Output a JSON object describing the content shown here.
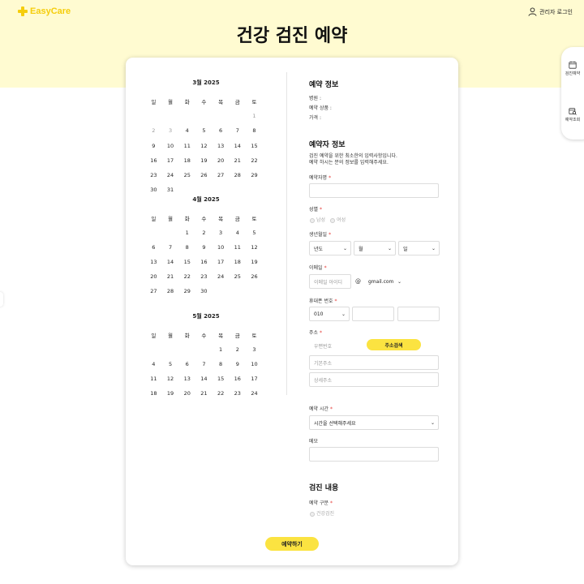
{
  "header": {
    "logo_text": "EasyCare",
    "admin_login": "관리자 로그인",
    "page_title": "건강 검진 예약"
  },
  "side_menu": {
    "checkup_label": "검진예약",
    "inquiry_label": "예약조회"
  },
  "calendars": [
    {
      "title": "3월 2025",
      "weekdays": [
        "일",
        "월",
        "화",
        "수",
        "목",
        "금",
        "토"
      ],
      "weeks": [
        [
          "",
          "",
          "",
          "",
          "",
          "",
          "1"
        ],
        [
          "2",
          "3",
          "4",
          "5",
          "6",
          "7",
          "8"
        ],
        [
          "9",
          "10",
          "11",
          "12",
          "13",
          "14",
          "15"
        ],
        [
          "16",
          "17",
          "18",
          "19",
          "20",
          "21",
          "22"
        ],
        [
          "23",
          "24",
          "25",
          "26",
          "27",
          "28",
          "29"
        ],
        [
          "30",
          "31",
          "",
          "",
          "",
          "",
          ""
        ]
      ]
    },
    {
      "title": "4월 2025",
      "weekdays": [
        "일",
        "월",
        "화",
        "수",
        "목",
        "금",
        "토"
      ],
      "weeks": [
        [
          "",
          "",
          "1",
          "2",
          "3",
          "4",
          "5"
        ],
        [
          "6",
          "7",
          "8",
          "9",
          "10",
          "11",
          "12"
        ],
        [
          "13",
          "14",
          "15",
          "16",
          "17",
          "18",
          "19"
        ],
        [
          "20",
          "21",
          "22",
          "23",
          "24",
          "25",
          "26"
        ],
        [
          "27",
          "28",
          "29",
          "30",
          "",
          "",
          ""
        ]
      ]
    },
    {
      "title": "5월 2025",
      "weekdays": [
        "일",
        "월",
        "화",
        "수",
        "목",
        "금",
        "토"
      ],
      "weeks": [
        [
          "",
          "",
          "",
          "",
          "1",
          "2",
          "3"
        ],
        [
          "4",
          "5",
          "6",
          "7",
          "8",
          "9",
          "10"
        ],
        [
          "11",
          "12",
          "13",
          "14",
          "15",
          "16",
          "17"
        ],
        [
          "18",
          "19",
          "20",
          "21",
          "22",
          "23",
          "24"
        ]
      ]
    }
  ],
  "reservation_info": {
    "title": "예약 정보",
    "hospital": "병원 :",
    "product": "예약 상품 :",
    "price": "가격 :"
  },
  "booker_info": {
    "title": "예약자 정보",
    "note_line1": "검진 예약을 위한 최소한의 입력사항입니다.",
    "note_line2": "예약 하시는 분의 정보를 입력해주세요.",
    "name_label": "예약자명",
    "required_mark": "*",
    "gender_label": "성별",
    "gender_male": "남성",
    "gender_female": "여성",
    "birth_label": "생년월일",
    "birth_year": "년도",
    "birth_month": "월",
    "birth_day": "일",
    "email_label": "이메일",
    "email_placeholder": "이메일 아이디",
    "email_at": "@",
    "email_domain": "gmail.com",
    "phone_label": "휴대폰 번호",
    "phone_prefix": "010",
    "address_label": "주소",
    "zipcode_placeholder": "우편번호",
    "address_search": "주소검색",
    "base_address_placeholder": "기본주소",
    "detail_address_placeholder": "상세주소",
    "time_label": "예약 시간",
    "time_placeholder": "시간을 선택해주세요",
    "memo_label": "메모"
  },
  "checkup_info": {
    "title": "검진 내용",
    "type_label": "예약 구분",
    "type_option": "건강검진"
  },
  "submit_label": "예약하기",
  "colors": {
    "brand_yellow": "#f5cd0c",
    "hero_bg": "#fffbd1",
    "button_yellow": "#fbe341",
    "required_red": "#e53935"
  }
}
